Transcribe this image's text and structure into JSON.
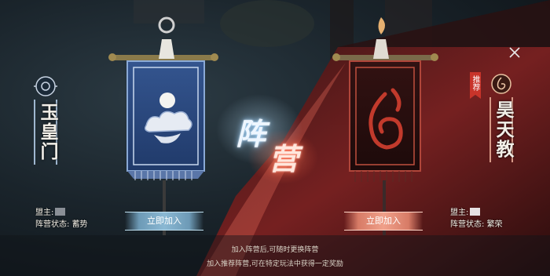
{
  "left_faction": {
    "name": "玉皇门",
    "leader_label": "盟主:",
    "status_label": "阵营状态:",
    "status_value": "蓄势",
    "join_label": "立即加入",
    "accent": "#3a5f9a"
  },
  "right_faction": {
    "name": "昊天教",
    "badge": "推荐",
    "leader_label": "盟主:",
    "status_label": "阵营状态:",
    "status_value": "繁荣",
    "join_label": "立即加入",
    "accent": "#b8302a"
  },
  "title": {
    "char1": "阵",
    "char2": "营"
  },
  "hints": {
    "line1": "加入阵营后,可随时更换阵营",
    "line2": "加入推荐阵营,可在特定玩法中获得一定奖励"
  },
  "icons": {
    "close": "close-icon",
    "left_emblem": "cloud-emblem-icon",
    "right_emblem": "flame-emblem-icon"
  }
}
